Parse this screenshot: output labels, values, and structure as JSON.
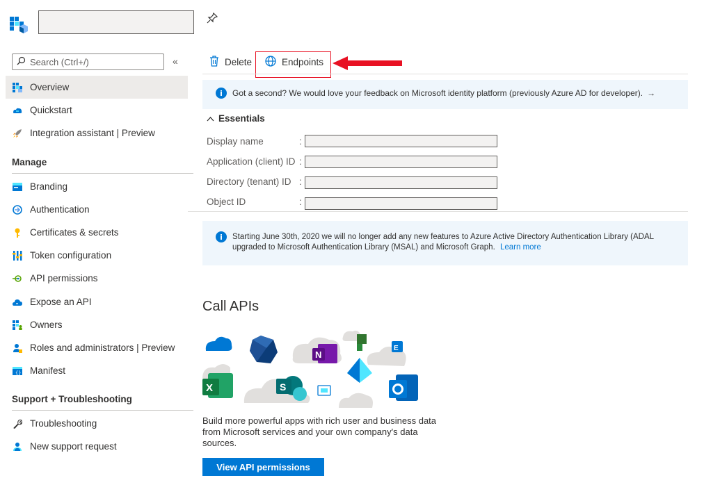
{
  "header": {
    "pin_glyph": "✗"
  },
  "sidebar": {
    "search_placeholder": "Search (Ctrl+/)",
    "collapse_glyph": "«",
    "top_items": [
      {
        "label": "Overview",
        "icon": "overview-icon"
      },
      {
        "label": "Quickstart",
        "icon": "quickstart-icon"
      },
      {
        "label": "Integration assistant | Preview",
        "icon": "rocket-icon"
      }
    ],
    "manage_header": "Manage",
    "manage_items": [
      {
        "label": "Branding",
        "icon": "branding-icon"
      },
      {
        "label": "Authentication",
        "icon": "authentication-icon"
      },
      {
        "label": "Certificates & secrets",
        "icon": "key-icon"
      },
      {
        "label": "Token configuration",
        "icon": "token-icon"
      },
      {
        "label": "API permissions",
        "icon": "api-permissions-icon"
      },
      {
        "label": "Expose an API",
        "icon": "cloud-icon"
      },
      {
        "label": "Owners",
        "icon": "owners-icon"
      },
      {
        "label": "Roles and administrators | Preview",
        "icon": "roles-icon"
      },
      {
        "label": "Manifest",
        "icon": "manifest-icon"
      }
    ],
    "support_header": "Support + Troubleshooting",
    "support_items": [
      {
        "label": "Troubleshooting",
        "icon": "wrench-icon"
      },
      {
        "label": "New support request",
        "icon": "support-person-icon"
      }
    ]
  },
  "toolbar": {
    "delete_label": "Delete",
    "endpoints_label": "Endpoints"
  },
  "feedback_banner": {
    "text": "Got a second? We would love your feedback on Microsoft identity platform (previously Azure AD for developer).",
    "arrow": "→"
  },
  "essentials": {
    "title": "Essentials",
    "fields": [
      {
        "label": "Display name",
        "value": ""
      },
      {
        "label": "Application (client) ID",
        "value": ""
      },
      {
        "label": "Directory (tenant) ID",
        "value": ""
      },
      {
        "label": "Object ID",
        "value": ""
      }
    ]
  },
  "adal_banner": {
    "line1": "Starting June 30th, 2020 we will no longer add any new features to Azure Active Directory Authentication Library (ADAL",
    "line2": "upgraded to Microsoft Authentication Library (MSAL) and Microsoft Graph.",
    "link": "Learn more"
  },
  "call_apis": {
    "title": "Call APIs",
    "description": "Build more powerful apps with rich user and business data from Microsoft services and your own company's data sources.",
    "button_label": "View API permissions"
  },
  "colors": {
    "accent": "#0078d4",
    "highlight_border": "#e81123",
    "banner_bg": "#eff6fc",
    "selected_bg": "#edebe9"
  }
}
